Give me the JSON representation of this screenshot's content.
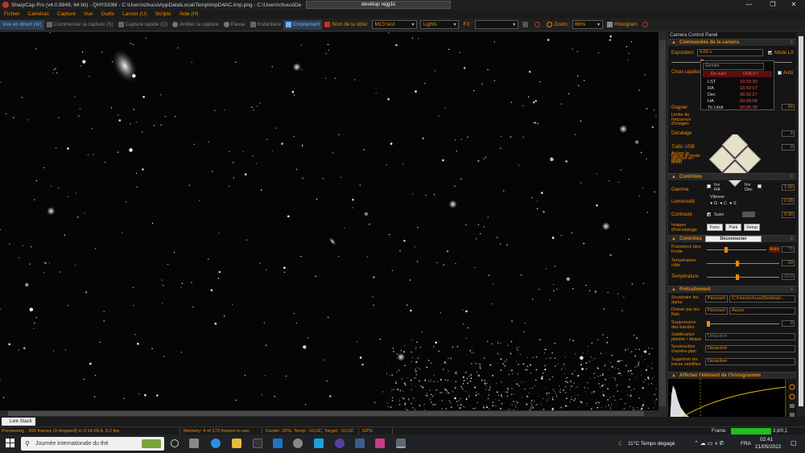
{
  "window": {
    "title": "SharpCap Pro (v4.0.8949, 64 bit) - QHY533M - C:\\Users\\chuuu\\AppData\\Local\\Temp\\tmpD4AC.tmp.png - C:\\Users\\chuuu\\De",
    "mini_tab": "desktop rejg1ii"
  },
  "menu": [
    "Fichier",
    "Caméras",
    "Capture",
    "Vue",
    "Outils",
    "Lancer (U)",
    "Scripts",
    "Aide (H)"
  ],
  "toolbar": {
    "live_view": "Vue en direct (W)",
    "start_capture": "Commencer la capture (S)",
    "quick_capture": "Capture rapide (Q)",
    "stop_capture": "Arrêter la capture",
    "pause": "Pause",
    "snapshot": "Instantané",
    "stacking": "Empilement",
    "target_label": "Nom de la cible:",
    "target_value": "M13 test",
    "frame_type": "Lights",
    "fx_label": "FX:",
    "zoom_label": "Zoom:",
    "zoom_value": "66%",
    "histogram": "Histogram"
  },
  "panel": {
    "title": "Camera Control Panel",
    "camera_section": "Commandes de la caméra",
    "exposure_label": "Exposition",
    "exposure_value": "4,00 s",
    "mode_lx": "Mode LX",
    "quick_choice": "Choix rapides",
    "auto": "Auto",
    "gain_label": "Gagner",
    "gain_value": "64",
    "framerate_label": "Limite de fréquence d'images",
    "offset_label": "Décalage",
    "offset_value": "5",
    "usb_label": "Trafic USB",
    "usb_value": "0",
    "stream_label": "Activer la diffusion en direct",
    "photo_mode_label": "Forcer le mode photo",
    "mount_dropdown": "Gemini",
    "mount_status": "En suivi",
    "mount_side": "OUEST",
    "lst_label": "LST",
    "lst_value": "10:33:30",
    "ra_label": "RA",
    "ra_value": "16:42:07",
    "dec_label": "Dec",
    "dec_value": "36:32:27",
    "ha_label": "HA",
    "ha_value": "00:09:08",
    "limit_label": "To Limit",
    "limit_value": "00:05:38",
    "controls_section": "Contrôles",
    "gamma_label": "Gamma",
    "gamma_value": "1.00",
    "inv_ra": "Inv RA",
    "inv_dec": "Inv Dec",
    "brightness_label": "Luminosité",
    "brightness_value": "0.00",
    "speed_label": "Vitesse",
    "speed_g": "G",
    "speed_c": "C",
    "speed_s": "S",
    "contrast_label": "Contraste",
    "contrast_value": "0.00",
    "follow_label": "Suivi",
    "timestamp_label": "Images d'horodatage",
    "func_btn": "Func",
    "park_btn": "Park",
    "setup_btn": "Setup",
    "cooling_section": "Contrôles",
    "disconnect_btn": "Déconnecter",
    "cooler_label": "Puissance plus froide",
    "cooler_auto": "Auto",
    "cooler_value": "75",
    "target_temp_label": "Température cible",
    "target_temp_value": "-10",
    "temp_label": "Température",
    "temp_value": "-10,0",
    "preprocess_section": "Prétraitement",
    "darks_label": "Soustraire les darks",
    "browse1": "Parcourir",
    "darks_path": "C:\\Users\\chuuu\\Desktop\\...",
    "flats_label": "Diviser par les flats",
    "browse2": "Parcourir",
    "flats_path": "Aucun",
    "banding_label": "Suppression des bandes",
    "banding_value": "0",
    "stabilize_label": "Stabilisation planète / disque",
    "stabilize_value": "Désactivé",
    "bg_sub_label": "Soustraction d'arrière-plan",
    "bg_sub_value": "Désactivé",
    "sat_label": "Supprimer les traces satellites",
    "sat_value": "Désactivé",
    "histogram_section": "Afficher l'élément de l'histogramme"
  },
  "tabs": {
    "live_stack": "Live Stack"
  },
  "status": {
    "preview": "Previewing : 366 frames (0 dropped) in 0:14:09,4, 0,2 fps",
    "memory": "Memory: 4 of 172 frames in use.",
    "cooler": "Cooler: 30%, Temp: -10,0C, Target: -10,0C",
    "gps": "GPS:",
    "frame_label": "Frame:",
    "frame_value": "3,9/0,1"
  },
  "taskbar": {
    "search": "Journée internationale du thé",
    "weather": "11°C Temps dégagé",
    "lang": "FRA",
    "time": "02:41",
    "date": "21/05/2022"
  }
}
